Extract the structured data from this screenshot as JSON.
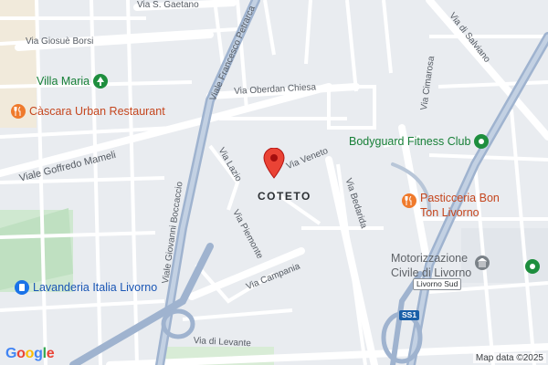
{
  "map": {
    "district": "COTETO",
    "streets": {
      "via_s_gaetano": "Via S. Gaetano",
      "via_giosue_borsi": "Via Giosuè Borsi",
      "viale_francesco_petrarca": "Viale Francesco Petrarca",
      "via_oberdan_chiesa": "Via Oberdan Chiesa",
      "viale_goffredo_mameli": "Viale Goffredo Mameli",
      "via_lazio": "Via Lazio",
      "via_veneto": "Via Veneto",
      "via_piemonte": "Via Piemonte",
      "via_campania": "Via Campania",
      "viale_giovanni_boccaccio": "Viale Giovanni Boccaccio",
      "via_di_levante": "Via di Levante",
      "via_bedarida": "Via Bedarida",
      "via_cimarosa": "Via Cimarosa",
      "via_di_salviano": "Via di Salviano"
    },
    "pois": {
      "villa_maria": "Villa Maria",
      "cascara": "Càscara Urban Restaurant",
      "bodyguard": "Bodyguard Fitness Club",
      "pasticceria_line1": "Pasticceria Bon",
      "pasticceria_line2": "Ton Livorno",
      "motorizzazione_line1": "Motorizzazione",
      "motorizzazione_line2": "Civile di Livorno",
      "lavanderia": "Lavanderia Italia Livorno"
    },
    "badges": {
      "livorno_sud": "Livorno Sud",
      "ss1": "SS1"
    },
    "logo": [
      "G",
      "o",
      "o",
      "g",
      "l",
      "e"
    ],
    "attribution": "Map data ©2025",
    "colors": {
      "background": "#e9ecf0",
      "road": "#ffffff",
      "highway": "#9fb3cf",
      "park": "#cfe8d0",
      "block": "#f3e6cc",
      "pin": "#ea4335"
    }
  }
}
